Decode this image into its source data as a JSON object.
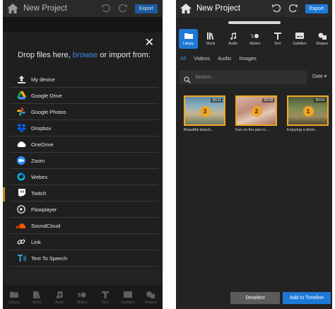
{
  "left": {
    "title": "New Project",
    "export_label": "Export",
    "modal": {
      "prompt_before": "Drop files here,",
      "browse": "browse",
      "prompt_after": "or import from:",
      "close_glyph": "✕",
      "sources": [
        {
          "label": "My device",
          "icon": "upload-icon"
        },
        {
          "label": "Google Drive",
          "icon": "google-drive-icon"
        },
        {
          "label": "Google Photos",
          "icon": "google-photos-icon"
        },
        {
          "label": "Dropbox",
          "icon": "dropbox-icon"
        },
        {
          "label": "OneDrive",
          "icon": "onedrive-icon"
        },
        {
          "label": "Zoom",
          "icon": "zoom-icon"
        },
        {
          "label": "Webex",
          "icon": "webex-icon"
        },
        {
          "label": "Twitch",
          "icon": "twitch-icon"
        },
        {
          "label": "Flowplayer",
          "icon": "flowplayer-icon"
        },
        {
          "label": "SoundCloud",
          "icon": "soundcloud-icon"
        },
        {
          "label": "Link",
          "icon": "link-icon"
        },
        {
          "label": "Text To Speech",
          "icon": "text-to-speech-icon"
        }
      ]
    },
    "nav": [
      {
        "label": "Library"
      },
      {
        "label": "Stock"
      },
      {
        "label": "Audio"
      },
      {
        "label": "Motion"
      },
      {
        "label": "Text"
      },
      {
        "label": "Subtitles"
      },
      {
        "label": "Shapes"
      }
    ]
  },
  "right": {
    "title": "New Project",
    "export_label": "Export",
    "nav": [
      {
        "label": "Library"
      },
      {
        "label": "Stock"
      },
      {
        "label": "Audio"
      },
      {
        "label": "Motion"
      },
      {
        "label": "Text"
      },
      {
        "label": "Subtitles"
      },
      {
        "label": "Shapes"
      }
    ],
    "tabs": [
      "All",
      "Videos",
      "Audio",
      "Images"
    ],
    "active_tab": "All",
    "search_placeholder": "Search...",
    "sort_label": "Date",
    "media": [
      {
        "number": "3",
        "duration": "00:21",
        "caption": "Beautiful beach..."
      },
      {
        "number": "2",
        "duration": "00:08",
        "caption": "Fun on the pier.m..."
      },
      {
        "number": "1",
        "duration": "00:04",
        "caption": "Enjoying a drink..."
      }
    ],
    "deselect_label": "Deselect",
    "add_label": "Add to Timeline"
  },
  "colors": {
    "accent": "#1e79d6",
    "selection": "#f0a623",
    "panel": "#232323"
  }
}
